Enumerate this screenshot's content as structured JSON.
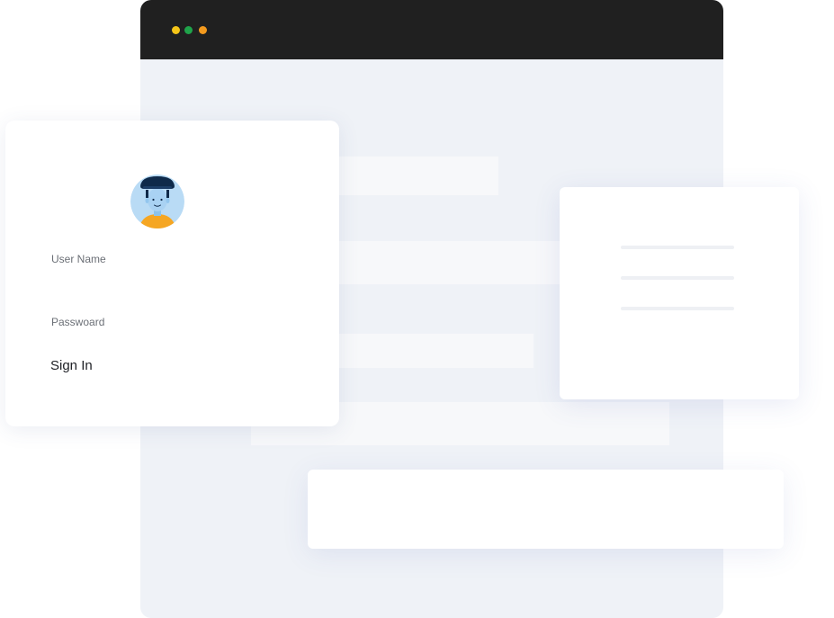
{
  "browser": {
    "window_dots": [
      {
        "color": "#f5c518"
      },
      {
        "color": "#1fa34a"
      },
      {
        "color": "#f39a1e"
      }
    ],
    "titlebar_color": "#202020",
    "content_background": "#eff2f7"
  },
  "login": {
    "avatar_icon": "user-avatar-icon",
    "username_label": "User Name",
    "password_label": "Passwoard",
    "signin_label": "Sign In"
  },
  "colors": {
    "avatar_bg": "#b9dbf5",
    "avatar_hair": "#0f2a4a",
    "avatar_shirt": "#f5a623"
  }
}
